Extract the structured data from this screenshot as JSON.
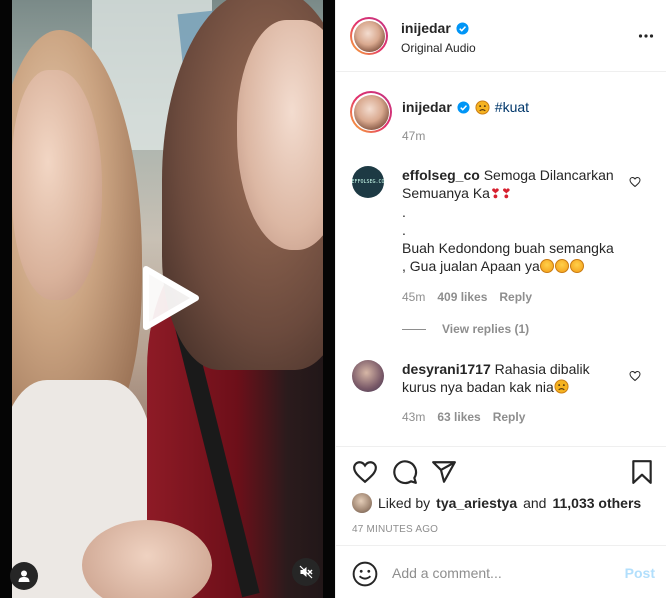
{
  "post": {
    "username": "inijedar",
    "audio": "Original Audio"
  },
  "caption": {
    "username": "inijedar",
    "hashtag": "#kuat",
    "time": "47m"
  },
  "comments": [
    {
      "username": "effolseg_co",
      "line1": "Semoga Dilancarkan",
      "line2": "Semuanya Ka",
      "line3": ".",
      "line4": ".",
      "line5": "Buah Kedondong buah semangka",
      "line6": ", Gua jualan Apaan ya",
      "time": "45m",
      "likes": "409 likes",
      "reply_label": "Reply",
      "view_replies": "View replies (1)"
    },
    {
      "username": "desyrani1717",
      "line1": "Rahasia dibalik",
      "line2": "kurus nya badan kak nia",
      "time": "43m",
      "likes": "63 likes",
      "reply_label": "Reply"
    }
  ],
  "likes": {
    "prefix": "Liked by",
    "user": "tya_ariestya",
    "and": "and",
    "others": "11,033 others"
  },
  "posted_time": "47 MINUTES AGO",
  "add_comment": {
    "placeholder": "Add a comment...",
    "post_label": "Post"
  },
  "icons": {
    "verified": "verified-badge-icon",
    "more": "more-options-icon",
    "heart": "heart-icon",
    "comment": "comment-icon",
    "share": "share-icon",
    "save": "bookmark-icon",
    "smile": "emoji-icon",
    "play": "play-icon",
    "user_tag": "user-tag-icon",
    "mute": "mute-icon"
  },
  "colors": {
    "verified_blue": "#0095f6",
    "hashtag": "#00376b",
    "muted_text": "#8e8e8e",
    "post_disabled": "#b2dffc"
  }
}
